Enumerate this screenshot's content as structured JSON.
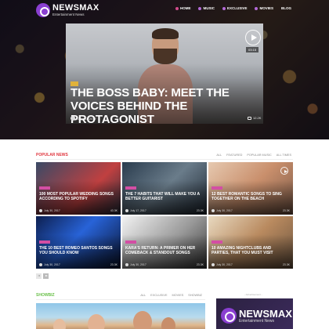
{
  "brand": {
    "name": "NEWSMAX",
    "tagline": "Entertainment News"
  },
  "nav": [
    {
      "label": "HOME",
      "active": true
    },
    {
      "label": "MUSIC",
      "active": false
    },
    {
      "label": "EXCLUSIVE",
      "active": false
    },
    {
      "label": "MOVIES",
      "active": false
    },
    {
      "label": "BLOG",
      "active": false
    }
  ],
  "hero": {
    "duration": "03:15",
    "title": "THE BOSS BABY: MEET THE VOICES BEHIND THE PROTAGONIST",
    "date": "July 30, 2017",
    "comments": "12.2K"
  },
  "popular": {
    "title": "POPULAR NEWS",
    "filters": [
      "ALL",
      "FEATURED",
      "POPULAR MUSIC",
      "ALL TIMES"
    ],
    "cards": [
      {
        "title": "100 most popular wedding songs according to Spotify",
        "date": "July 30, 2017",
        "count": "43.3K"
      },
      {
        "title": "The 7 habits that will make you a better guitarist",
        "date": "July 17, 2017",
        "count": "23.3K"
      },
      {
        "title": "12 best romantic songs to sing together on the beach",
        "date": "July 30, 2017",
        "count": "23.3K"
      },
      {
        "title": "The 10 best romeo santos songs you should know",
        "date": "July 30, 2017",
        "count": "23.3K"
      },
      {
        "title": "Kara's return: a primer on her comeback & standout songs",
        "date": "July 30, 2017",
        "count": "23.3K"
      },
      {
        "title": "10 amazing nightclubs and parties, that you must visit",
        "date": "July 30, 2017",
        "count": "23.3K"
      }
    ]
  },
  "showbiz": {
    "title": "SHOWBIZ",
    "filters": [
      "ALL",
      "EXCLUSIVE",
      "MOVIES",
      "SHOWBIZ"
    ]
  },
  "ad": {
    "label": "- Advertisement -",
    "name": "NEWSMAX",
    "tagline": "Entertainment News"
  },
  "colors": {
    "accent": "#8a3fd1",
    "popular": "#e0373f",
    "showbiz": "#6bc04b",
    "tag": "#d34ea4"
  }
}
